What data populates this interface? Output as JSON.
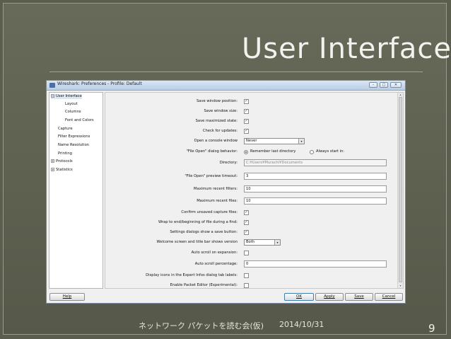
{
  "slide": {
    "title": "User Interface",
    "footer_text": "ネットワーク パケットを読む会(仮)",
    "footer_date": "2014/10/31",
    "page_number": "9"
  },
  "window": {
    "title": "Wireshark: Preferences - Profile: Default",
    "controls": {
      "minimize": "–",
      "maximize": "□",
      "close": "✕"
    }
  },
  "tree": {
    "items": [
      {
        "label": "User Interface",
        "expander": "−",
        "selected": true
      },
      {
        "label": "Layout"
      },
      {
        "label": "Columns"
      },
      {
        "label": "Font and Colors"
      },
      {
        "label": "Capture"
      },
      {
        "label": "Filter Expressions"
      },
      {
        "label": "Name Resolution"
      },
      {
        "label": "Printing"
      },
      {
        "label": "Protocols",
        "expander": "+"
      },
      {
        "label": "Statistics",
        "expander": "+"
      }
    ]
  },
  "prefs": {
    "save_window_position": {
      "label": "Save window position:",
      "checked": true
    },
    "save_window_size": {
      "label": "Save window size:",
      "checked": true
    },
    "save_maximized_state": {
      "label": "Save maximized state:",
      "checked": true
    },
    "check_for_updates": {
      "label": "Check for updates:",
      "checked": true
    },
    "open_console_window": {
      "label": "Open a console window",
      "value": "Never"
    },
    "file_open_behavior": {
      "label": "\"File Open\" dialog behavior:",
      "options": [
        "Remember last directory",
        "Always start in:"
      ],
      "selected": "Remember last directory"
    },
    "directory": {
      "label": "Directory:",
      "value": "C:¥Users¥Murachi¥Documents"
    },
    "file_open_preview_timeout": {
      "label": "\"File Open\" preview timeout:",
      "value": "3"
    },
    "maximum_recent_filters": {
      "label": "Maximum recent filters:",
      "value": "10"
    },
    "maximum_recent_files": {
      "label": "Maximum recent files:",
      "value": "10"
    },
    "confirm_unsaved": {
      "label": "Confirm unsaved capture files:",
      "checked": true
    },
    "wrap_find": {
      "label": "Wrap to end/beginning of file during a find:",
      "checked": true
    },
    "settings_save_button": {
      "label": "Settings dialogs show a save button:",
      "checked": true
    },
    "welcome_title_version": {
      "label": "Welcome screen and title bar shows version",
      "value": "Both"
    },
    "auto_scroll_expansion": {
      "label": "Auto scroll on expansion:",
      "checked": false
    },
    "auto_scroll_percentage": {
      "label": "Auto scroll percentage:",
      "value": "0"
    },
    "expert_infos_icons": {
      "label": "Display icons in the Expert Infos dialog tab labels:",
      "checked": false
    },
    "enable_packet_editor": {
      "label": "Enable Packet Editor (Experimental):",
      "checked": false
    }
  },
  "buttons": {
    "help": "Help",
    "ok": "OK",
    "apply": "Apply",
    "save": "Save",
    "cancel": "Cancel"
  },
  "icons": {
    "check": "✓",
    "dropdown": "▾",
    "scroll_up": "▴",
    "scroll_down": "▾"
  }
}
